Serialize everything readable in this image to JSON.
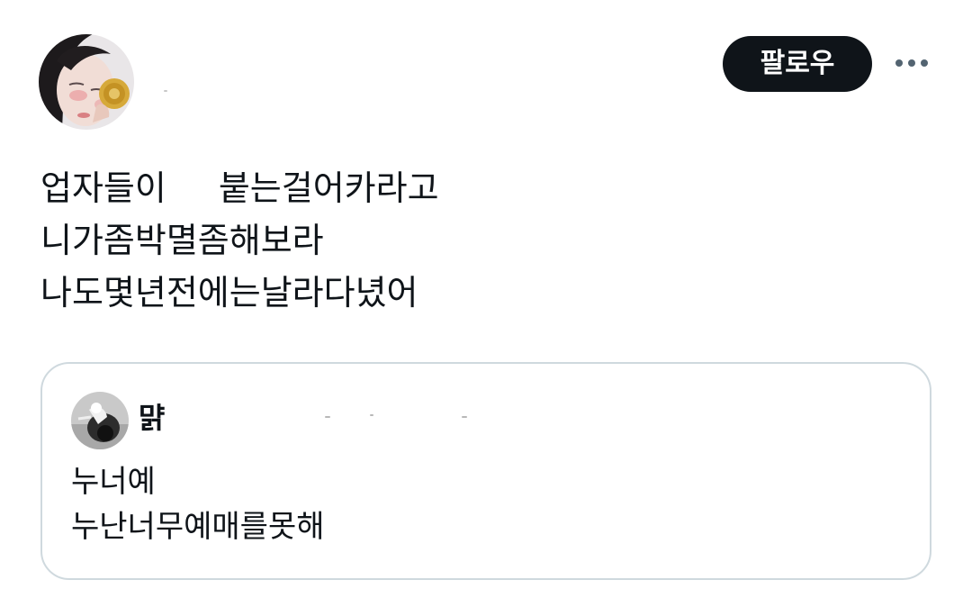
{
  "post": {
    "author_avatar": "avatar-photo",
    "follow_label": "팔로우",
    "more_icon": "more-horizontal-icon",
    "text_lines": [
      "업자들이",
      "붙는걸어카라고",
      "니가좀박멸좀해보라",
      "나도몇년전에는날라다녔어"
    ]
  },
  "quote": {
    "author_avatar": "avatar-photo",
    "author_name": "먉",
    "text_lines": [
      "누너예",
      "누난너무예매를못해"
    ]
  },
  "colors": {
    "text": "#0f1419",
    "follow_bg": "#0f1419",
    "follow_fg": "#ffffff",
    "card_border": "#cfd9de"
  }
}
